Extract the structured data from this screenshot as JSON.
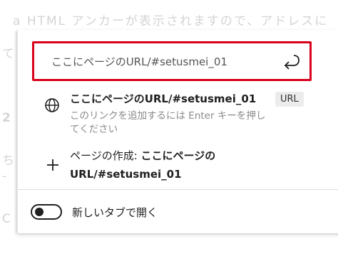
{
  "background_page": {
    "top_line": "a HTML アンカーが表示されますので、アドレスに",
    "fragments": [
      "て",
      "2",
      "ち",
      "-",
      "C"
    ]
  },
  "address_bar": {
    "value": "ここにページのURL/#setusmei_01",
    "highlight_color": "#d9001b",
    "enter_icon": "enter-return-icon"
  },
  "suggestions": [
    {
      "icon": "globe-icon",
      "title": "ここにページのURL/#setusmei_01",
      "description": "このリンクを追加するには Enter キーを押してください",
      "badge": "URL"
    },
    {
      "icon": "plus-icon",
      "prefix": "ページの作成: ",
      "title": "ここにページのURL/#setusmei_01"
    }
  ],
  "new_tab_toggle": {
    "label": "新しいタブで開く",
    "checked": false
  }
}
